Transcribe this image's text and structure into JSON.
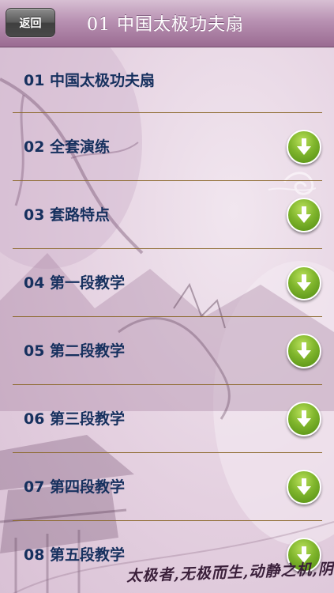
{
  "nav": {
    "back_label": "返回",
    "title": "01 中国太极功夫扇"
  },
  "items": [
    {
      "label": "01 中国太极功夫扇",
      "download": false
    },
    {
      "label": "02 全套演练",
      "download": true
    },
    {
      "label": "03 套路特点",
      "download": true
    },
    {
      "label": "04 第一段教学",
      "download": true
    },
    {
      "label": "05 第二段教学",
      "download": true
    },
    {
      "label": "06 第三段教学",
      "download": true
    },
    {
      "label": "07 第四段教学",
      "download": true
    },
    {
      "label": "08 第五段教学",
      "download": true
    }
  ],
  "background": {
    "calligraphy": "太极者,无极而生,动静之机,阴阳"
  },
  "colors": {
    "label_text": "#16305e",
    "divider": "#8d6a2e",
    "download_green": "#7fb52c",
    "nav_purple": "#b891b2"
  },
  "icons": {
    "download": "download-arrow-icon"
  }
}
